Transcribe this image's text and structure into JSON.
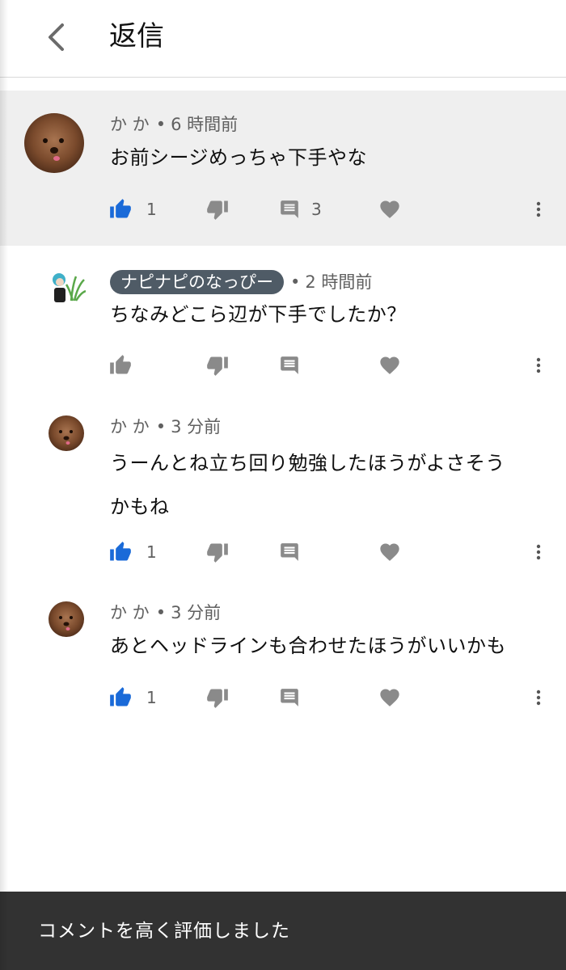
{
  "header": {
    "title": "返信",
    "back_icon": "arrow-back-icon"
  },
  "comments": [
    {
      "author": "か か",
      "author_chip": false,
      "time": "6 時間前",
      "text_lines": [
        "お前シージめっちゃ下手やな"
      ],
      "likes": "1",
      "liked": true,
      "replies": "3"
    },
    {
      "author": "ナピナピのなっぴー",
      "author_chip": true,
      "time": "2 時間前",
      "text_lines": [
        "ちなみどこら辺が下手でしたか？"
      ],
      "likes": "",
      "liked": false,
      "replies": ""
    },
    {
      "author": "か か",
      "author_chip": false,
      "time": "3 分前",
      "text_lines": [
        "うーんとね立ち回り勉強したほうがよさそう",
        "かもね"
      ],
      "likes": "1",
      "liked": true,
      "replies": ""
    },
    {
      "author": "か か",
      "author_chip": false,
      "time": "3 分前",
      "text_lines": [
        "あとヘッドラインも合わせたほうがいいかも"
      ],
      "likes": "1",
      "liked": true,
      "replies": ""
    }
  ],
  "separator": "•",
  "snackbar": {
    "text": "コメントを高く評価しました"
  },
  "colors": {
    "like_active": "#1a6ad8",
    "icon_gray": "#8a8a8a",
    "chip_bg": "#4f5b66",
    "snackbar_bg": "#323232"
  }
}
